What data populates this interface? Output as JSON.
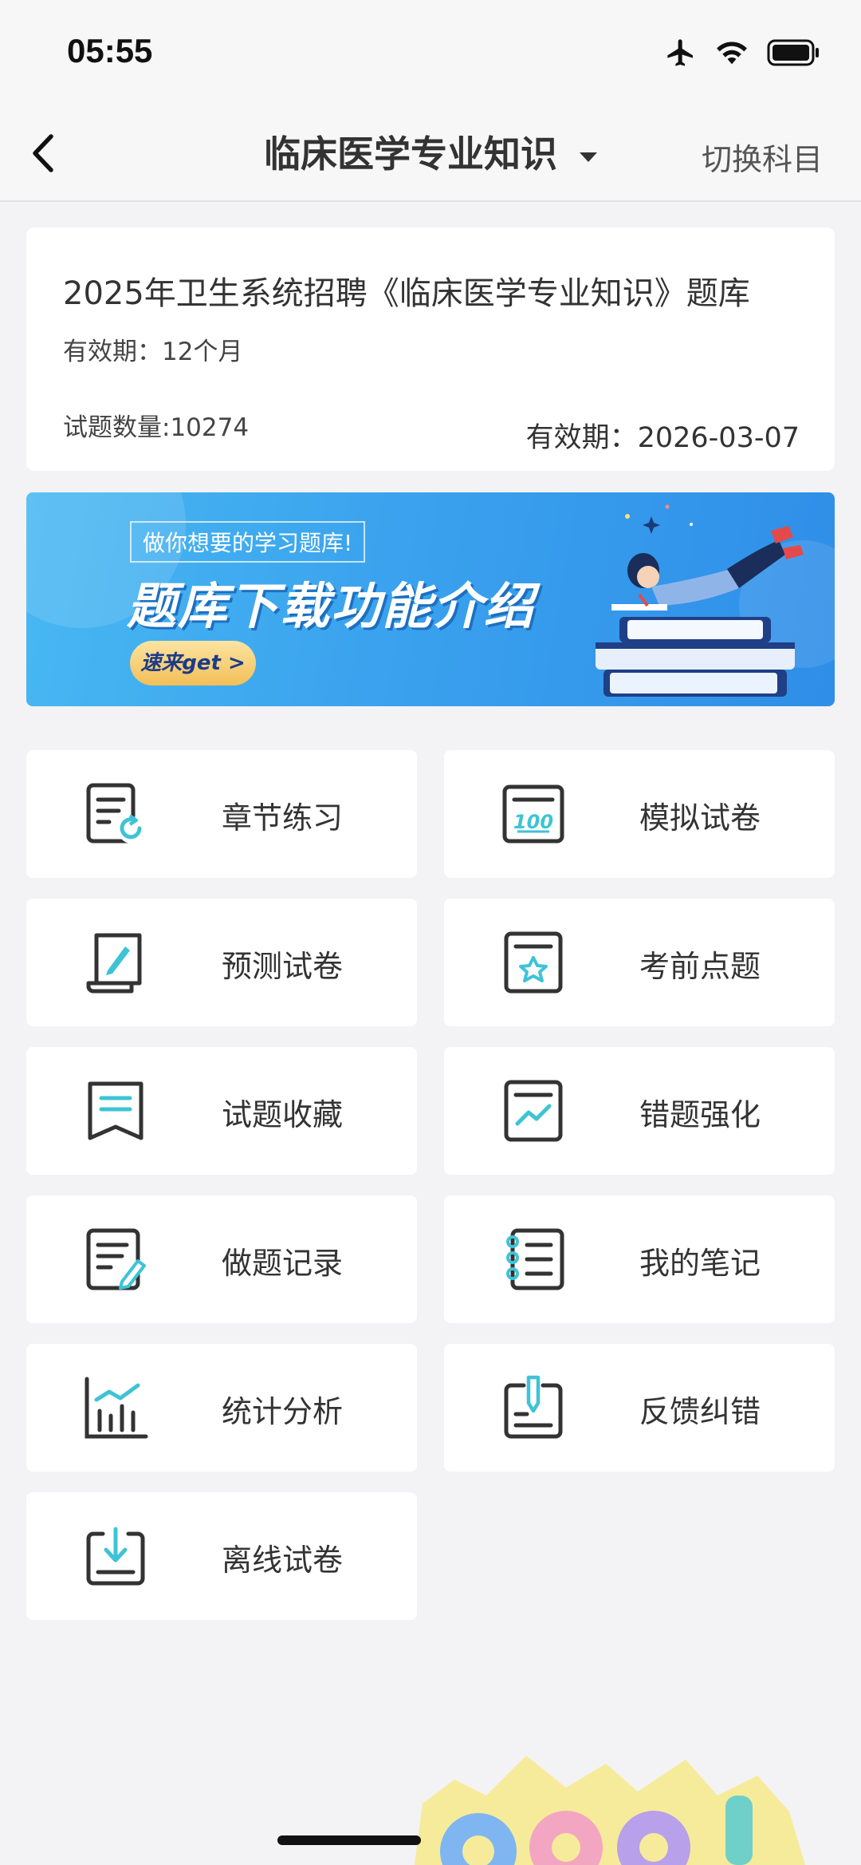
{
  "status": {
    "time": "05:55"
  },
  "nav": {
    "title": "临床医学专业知识",
    "switch_label": "切换科目"
  },
  "info": {
    "title": "2025年卫生系统招聘《临床医学专业知识》题库",
    "validity": "有效期：12个月",
    "count": "试题数量:10274",
    "expiry": "有效期：2026-03-07"
  },
  "banner": {
    "subtitle": "做你想要的学习题库!",
    "title": "题库下载功能介绍",
    "button": "速来get >"
  },
  "menu": [
    {
      "label": "章节练习",
      "icon": "chapter-practice-icon"
    },
    {
      "label": "模拟试卷",
      "icon": "mock-exam-icon"
    },
    {
      "label": "预测试卷",
      "icon": "prediction-paper-icon"
    },
    {
      "label": "考前点题",
      "icon": "pre-exam-tips-icon"
    },
    {
      "label": "试题收藏",
      "icon": "bookmark-icon"
    },
    {
      "label": "错题强化",
      "icon": "wrong-answers-icon"
    },
    {
      "label": "做题记录",
      "icon": "practice-record-icon"
    },
    {
      "label": "我的笔记",
      "icon": "notebook-icon"
    },
    {
      "label": "统计分析",
      "icon": "statistics-icon"
    },
    {
      "label": "反馈纠错",
      "icon": "feedback-icon"
    },
    {
      "label": "离线试卷",
      "icon": "offline-download-icon"
    }
  ],
  "colors": {
    "accent": "#3ec3d6",
    "icon_stroke": "#333333"
  }
}
